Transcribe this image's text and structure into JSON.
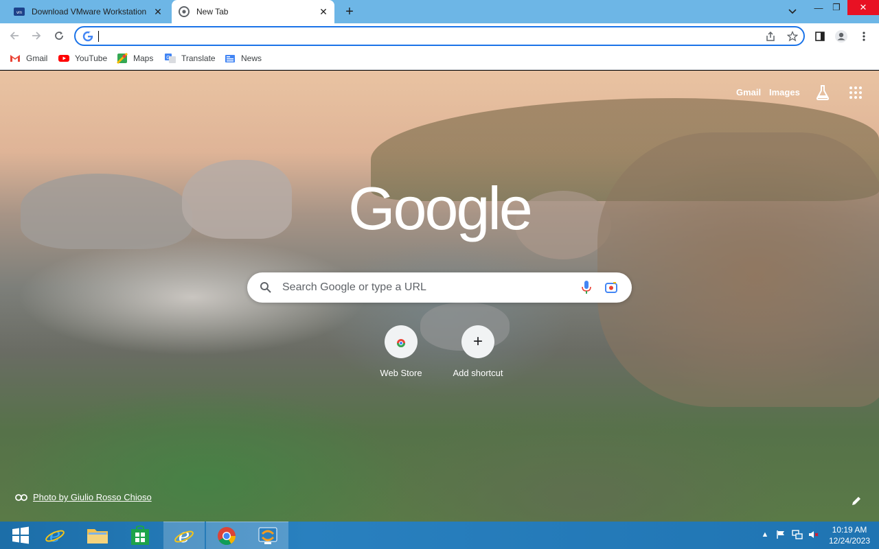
{
  "window": {
    "tabs": [
      {
        "label": "Download VMware Workstation",
        "active": false
      },
      {
        "label": "New Tab",
        "active": true
      }
    ],
    "controls": {
      "minimize": "—",
      "restore": "❐",
      "close": "✕"
    }
  },
  "toolbar": {
    "omnibox_value": "",
    "icons": [
      "back-icon",
      "forward-icon",
      "reload-icon",
      "share-icon",
      "star-icon",
      "side-panel-icon",
      "profile-icon",
      "menu-icon"
    ]
  },
  "bookmarks": [
    {
      "label": "Gmail",
      "icon": "gmail-icon"
    },
    {
      "label": "YouTube",
      "icon": "youtube-icon"
    },
    {
      "label": "Maps",
      "icon": "maps-icon"
    },
    {
      "label": "Translate",
      "icon": "translate-icon"
    },
    {
      "label": "News",
      "icon": "news-icon"
    }
  ],
  "ntp": {
    "header_links": {
      "gmail": "Gmail",
      "images": "Images"
    },
    "logo": "Google",
    "search_placeholder": "Search Google or type a URL",
    "shortcuts": [
      {
        "label": "Web Store",
        "icon": "chrome-web-store-icon"
      },
      {
        "label": "Add shortcut",
        "icon": "plus-icon"
      }
    ],
    "photo_credit": "Photo by Giulio Rosso Chioso"
  },
  "taskbar": {
    "pinned": [
      "windows-start-icon",
      "internet-explorer-icon",
      "file-explorer-icon",
      "store-icon",
      "internet-explorer-icon",
      "chrome-icon",
      "vmware-icon"
    ],
    "clock": {
      "time": "10:19 AM",
      "date": "12/24/2023"
    }
  },
  "colors": {
    "tabstrip": "#6db6e6",
    "accent": "#1a73e8",
    "taskbar": "#2980bf",
    "close_red": "#e81123"
  }
}
